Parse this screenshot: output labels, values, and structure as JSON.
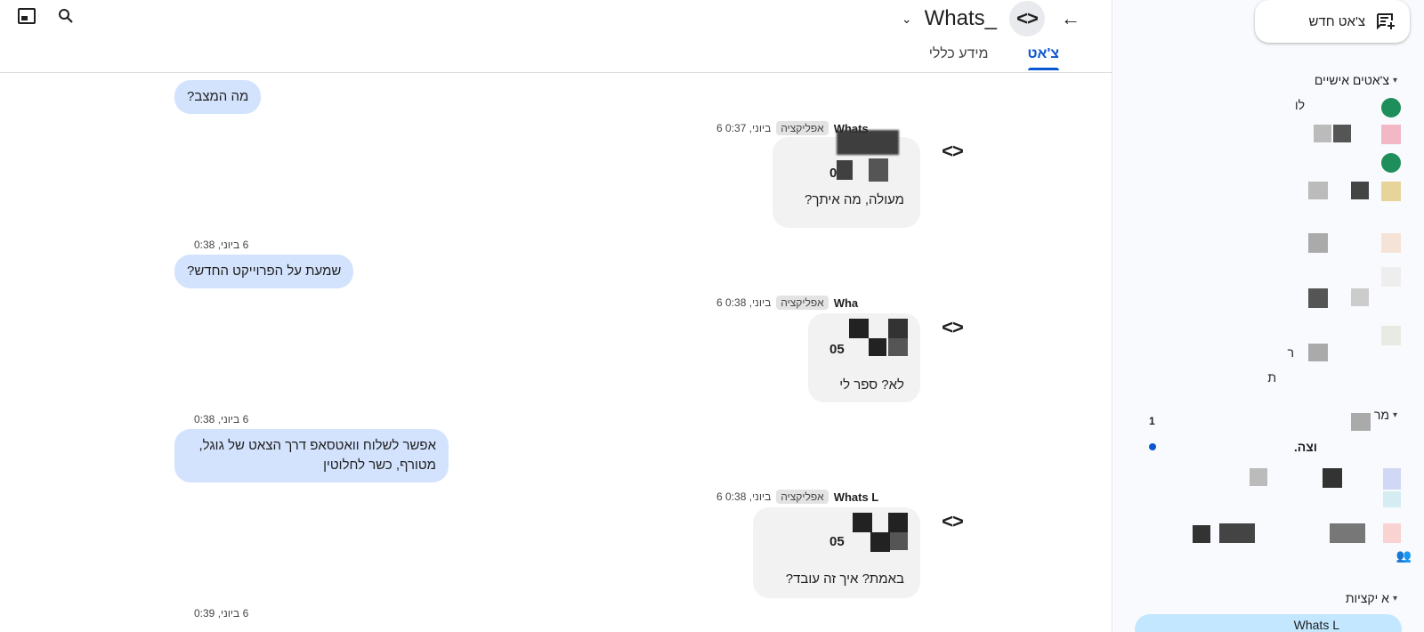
{
  "header": {
    "title": "Whats_",
    "app_avatar": "<>",
    "back_icon": "arrow-back-icon",
    "tabs": [
      {
        "label": "צ'אט",
        "active": true
      },
      {
        "label": "מידע כללי",
        "active": false
      }
    ]
  },
  "messages": [
    {
      "type": "out",
      "text": "מה המצב?"
    },
    {
      "type": "in",
      "sender": "Whats",
      "badge": "אפליקציה",
      "time": "6 ביוני, 0:37",
      "phone": "0",
      "text": "מעולה, מה איתך?"
    },
    {
      "type": "out",
      "time": "6 ביוני, 0:38",
      "text": "שמעת על הפרוייקט החדש?"
    },
    {
      "type": "in",
      "sender": "Wha",
      "badge": "אפליקציה",
      "time": "6 ביוני, 0:38",
      "phone": "05",
      "text": "לא? ספר לי"
    },
    {
      "type": "out",
      "time": "6 ביוני, 0:38",
      "text_line1": "אפשר לשלוח וואטסאפ דרך הצאט של גוגל,",
      "text_line2": "מטורף, כשר לחלוטין"
    },
    {
      "type": "in",
      "sender": "Whats L",
      "badge": "אפליקציה",
      "time": "6 ביוני, 0:38",
      "phone": "05",
      "text": "באמת? איך זה עובד?"
    },
    {
      "type": "out",
      "time": "6 ביוני, 0:39"
    }
  ],
  "sidebar": {
    "new_chat_label": "צ'אט חדש",
    "direct_section": "צ'אטים אישיים",
    "rows": [
      {
        "label": "לו"
      },
      {
        "label": "ר"
      },
      {
        "label": "ת"
      }
    ],
    "spaces_section": "מר",
    "spaces_count": "1",
    "spaces_row_label": "וצה.",
    "apps_section": "א   יקציות",
    "active_app_label": "Whats L"
  },
  "colors": {
    "accent": "#0b57d0",
    "outgoing_bubble": "#d3e3fd",
    "incoming_bubble": "#f2f2f2",
    "active_item": "#c2e7ff"
  }
}
